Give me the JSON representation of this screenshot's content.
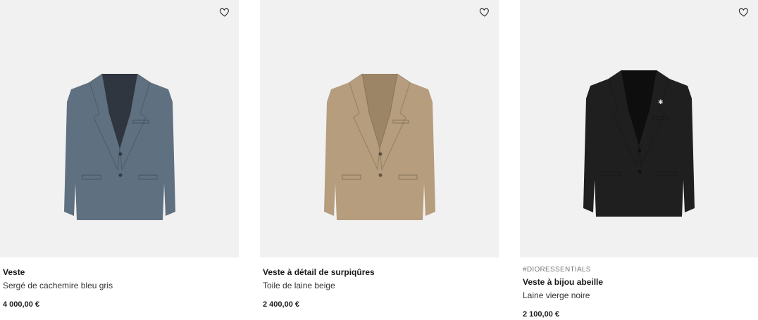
{
  "products": [
    {
      "tag": "",
      "title": "Veste",
      "subtitle": "Sergé de cachemire bleu gris",
      "price": "4 000,00 €",
      "color": "#5f7080",
      "lining": "#2f3640",
      "icon": "heart-outline-icon"
    },
    {
      "tag": "",
      "title": "Veste à détail de surpiqûres",
      "subtitle": "Toile de laine beige",
      "price": "2 400,00 €",
      "color": "#b59d7d",
      "lining": "#9c8466",
      "icon": "heart-outline-icon"
    },
    {
      "tag": "#DIORESSENTIALS",
      "title": "Veste à bijou abeille",
      "subtitle": "Laine vierge noire",
      "price": "2 100,00 €",
      "color": "#1f1f1f",
      "lining": "#0e0e0e",
      "icon": "heart-outline-icon"
    }
  ]
}
